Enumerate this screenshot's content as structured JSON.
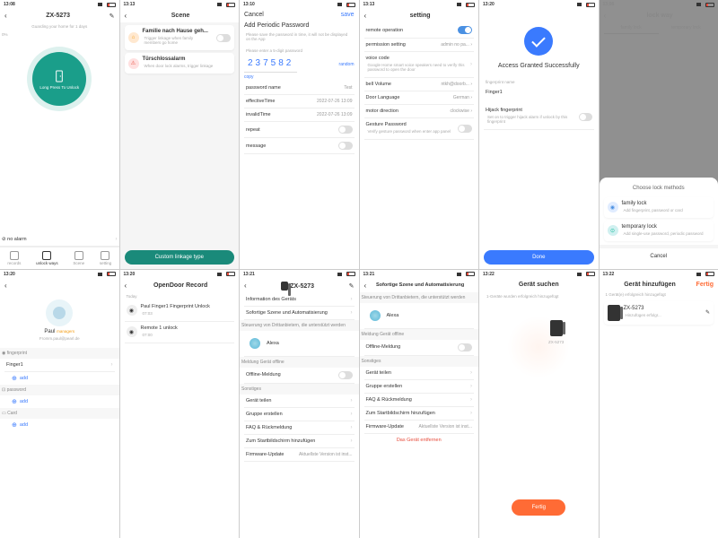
{
  "s1": {
    "time": "13:08",
    "title": "ZX-5273",
    "guard": "Guarding your home for 1 days",
    "unlock": "Long Press To Unlock",
    "alarm": "no alarm",
    "pct": "0%",
    "tabs": [
      "records",
      "unlock ways",
      "Scene",
      "setting"
    ]
  },
  "s2": {
    "time": "13:13",
    "title": "Scene",
    "c1": {
      "t": "Familie nach Hause geh...",
      "s": "Trigger linkage when family members go home"
    },
    "c2": {
      "t": "Türschlossalarm",
      "s": "When door lock alarms, trigger linkage"
    },
    "btn": "Custom linkage type"
  },
  "s3": {
    "time": "13:10",
    "cancel": "Cancel",
    "save": "save",
    "title": "Add Periodic Password",
    "hint": "Please save the password in time, it will not be displayed on the App",
    "hint2": "Please enter a 5-digit password",
    "digits": "237582",
    "random": "random",
    "copy": "copy",
    "rows": {
      "pn": "password name",
      "pnv": "Test",
      "et": "effectiveTime",
      "etv": "2022-07-26 13:09",
      "it": "invalidTime",
      "itv": "2022-07-26 13:09",
      "rp": "repeat",
      "msg": "message"
    }
  },
  "s4": {
    "time": "13:13",
    "title": "setting",
    "rows": {
      "ro": "remote operation",
      "ps": "permission setting",
      "psv": "admin no pa...",
      "vc": "voice code",
      "vcs": "Google Home smart voice speakers need to verify this password to open the door",
      "bv": "bell Volume",
      "bvv": "ntkh@doorb...",
      "dl": "Door Language",
      "dlv": "German",
      "md": "motor direction",
      "mdv": "clockwise",
      "gp": "Gesture Password",
      "gps": "Verify gesture password when enter app panel"
    }
  },
  "s5": {
    "time": "13:20",
    "msg": "Access Granted Successfully",
    "fn": "fingerprint name",
    "fv": "Finger1",
    "hf": "Hijack fingerprint",
    "hfs": "Set on to trigger hijack alarm if unlock by this fingerprint",
    "done": "Done"
  },
  "s6": {
    "time": "13:08",
    "title": "lock way",
    "t1": "family lock",
    "t2": "temporary lock",
    "choose": "Choose lock methods",
    "c1": {
      "t": "family lock",
      "s": "Add fingerprint, password or card"
    },
    "c2": {
      "t": "temporary lock",
      "s": "Add single-use password, periodic password"
    },
    "cancel": "Cancel"
  },
  "s7": {
    "time": "13:20",
    "name": "Paul",
    "tag": "managers",
    "email": "Fromm.paul@pearl.de",
    "h1": "fingerprint",
    "v1": "Finger1",
    "h2": "password",
    "h3": "Card",
    "add": "add"
  },
  "s8": {
    "time": "13:20",
    "title": "OpenDoor Record",
    "today": "Today",
    "r1": {
      "t": "Paul Finger1 Fingerprint Unlock",
      "tm": "07:03"
    },
    "r2": {
      "t": "Remote 1 unlock",
      "tm": "07:00"
    }
  },
  "s9": {
    "time": "13:21",
    "title": "ZX-5273",
    "rows": {
      "ig": "Information des Geräts",
      "sz": "Sofortige Szene und Automatisierung",
      "sd": "Steuerung von Drittanbietern, die unterstützt werden",
      "al": "Alexa",
      "mo": "Meldung Gerät offline",
      "om": "Offline-Meldung",
      "so": "Sonstiges",
      "gt": "Gerät teilen",
      "ge": "Gruppe erstellen",
      "fq": "FAQ & Rückmeldung",
      "zs": "Zum Startbildschirm hinzufügen",
      "fu": "Firmware-Update",
      "fuv": "Aktuellste Version ist inst..."
    }
  },
  "s10": {
    "time": "13:21",
    "title": "Sofortige Szene und Automatisierung",
    "sd": "Steuerung von Drittanbietern, die unterstützt werden",
    "al": "Alexa",
    "mo": "Meldung Gerät offline",
    "om": "Offline-Meldung",
    "so": "Sonstiges",
    "gt": "Gerät teilen",
    "ge": "Gruppe erstellen",
    "fq": "FAQ & Rückmeldung",
    "zs": "Zum Startbildschirm hinzufügen",
    "fu": "Firmware-Update",
    "fuv": "Aktuellste Version ist inst...",
    "rm": "Das Gerät entfernen"
  },
  "s11": {
    "time": "13:22",
    "title": "Gerät suchen",
    "msg": "1-Geräte wurden erfolgreich hinzugefügt",
    "dev": "ZX-5273",
    "done": "Fertig"
  },
  "s12": {
    "time": "13:22",
    "title": "Gerät hinzufügen",
    "done": "Fertig",
    "msg": "1 Gerät(e) erfolgreich hinzugefügt",
    "dev": "ZX-5273",
    "sub": "Hinzufügen erfolgr..."
  }
}
